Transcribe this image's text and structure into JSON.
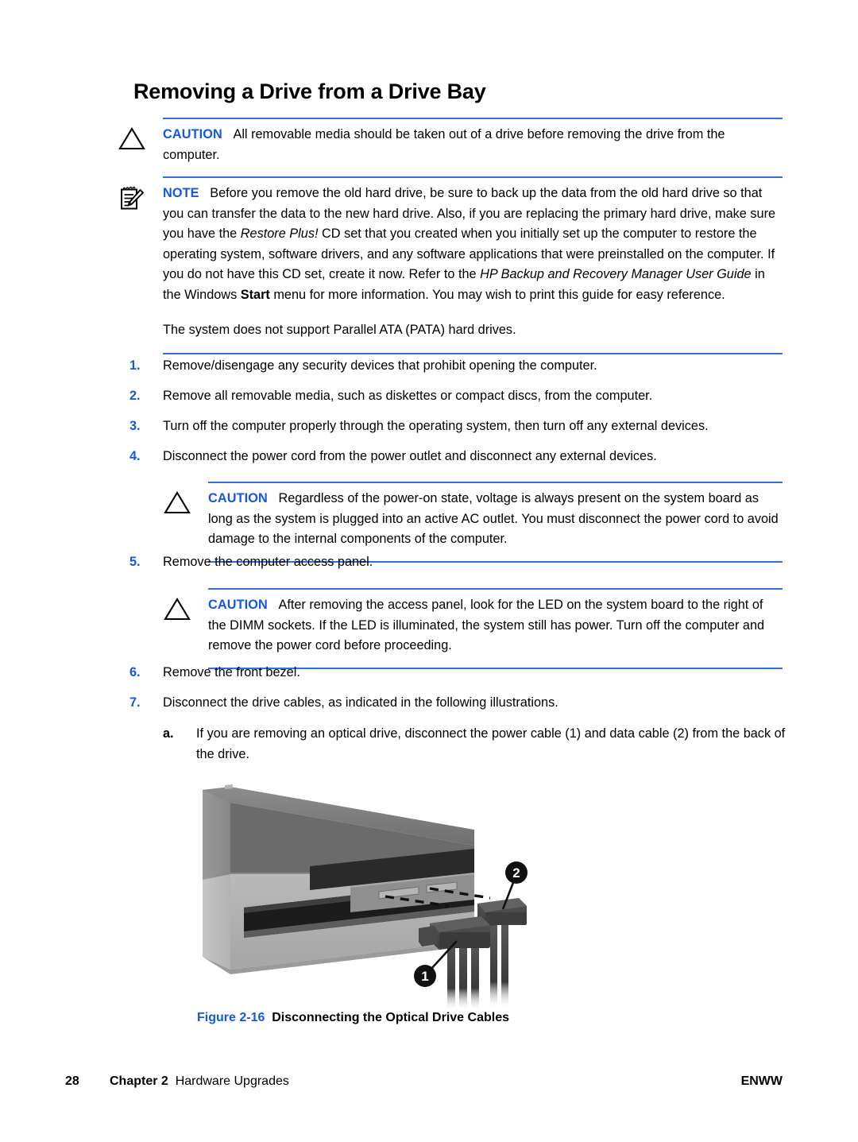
{
  "document": {
    "title": "Removing a Drive from a Drive Bay"
  },
  "colors": {
    "accent_blue": "#1557e0",
    "rule_blue": "#2f6fe0",
    "text_black": "#000000",
    "page_background": "#ffffff"
  },
  "admonitions": [
    {
      "id": "caution-removable-media",
      "icon": "caution-triangle-icon",
      "label": "CAUTION",
      "paragraphs": [
        "All removable media should be taken out of a drive before removing the drive from the computer."
      ]
    },
    {
      "id": "note-backup-data",
      "icon": "note-pad-icon",
      "label": "NOTE",
      "paragraphs": [
        "Before you remove the old hard drive, be sure to back up the data from the old hard drive so that you can transfer the data to the new hard drive. Also, if you are replacing the primary hard drive, make sure you have the Restore Plus! CD set that you created when you initially set up the computer to restore the operating system, software drivers, and any software applications that were preinstalled on the computer. If you do not have this CD set, create it now. Refer to the HP Backup and Recovery Manager User Guide in the Windows Start menu for more information. You may wish to print this guide for easy reference.",
        "The system does not support Parallel ATA (PATA) hard drives."
      ],
      "emphasis": {
        "italic_1": "Restore Plus!",
        "italic_2": "HP Backup and Recovery Manager User Guide",
        "bold_1": "Start"
      }
    },
    {
      "id": "caution-voltage-present",
      "icon": "caution-triangle-icon",
      "label": "CAUTION",
      "paragraphs": [
        "Regardless of the power-on state, voltage is always present on the system board as long as the system is plugged into an active AC outlet. You must disconnect the power cord to avoid damage to the internal components of the computer."
      ]
    },
    {
      "id": "caution-led-check",
      "icon": "caution-triangle-icon",
      "label": "CAUTION",
      "paragraphs": [
        "After removing the access panel, look for the LED on the system board to the right of the DIMM sockets. If the LED is illuminated, the system still has power. Turn off the computer and remove the power cord before proceeding."
      ]
    }
  ],
  "steps": [
    {
      "num": "1.",
      "text": "Remove/disengage any security devices that prohibit opening the computer."
    },
    {
      "num": "2.",
      "text": "Remove all removable media, such as diskettes or compact discs, from the computer."
    },
    {
      "num": "3.",
      "text": "Turn off the computer properly through the operating system, then turn off any external devices."
    },
    {
      "num": "4.",
      "text": "Disconnect the power cord from the power outlet and disconnect any external devices."
    },
    {
      "num": "5.",
      "text": "Remove the computer access panel."
    },
    {
      "num": "6.",
      "text": "Remove the front bezel."
    },
    {
      "num": "7.",
      "text": "Disconnect the drive cables, as indicated in the following illustrations."
    }
  ],
  "substeps": [
    {
      "num": "a.",
      "text": "If you are removing an optical drive, disconnect the power cable (1) and data cable (2) from the back of the drive."
    }
  ],
  "figure": {
    "number": "Figure 2-16",
    "title": "Disconnecting the Optical Drive Cables",
    "callouts": [
      {
        "id": "1",
        "label": "1",
        "meaning": "power cable connector"
      },
      {
        "id": "2",
        "label": "2",
        "meaning": "data cable connector"
      }
    ],
    "alt": "Line drawing of an optical drive viewed from the rear with power and data cable connectors being pulled away"
  },
  "footer": {
    "page_number": "28",
    "chapter_label": "Chapter 2",
    "chapter_title": "Hardware Upgrades",
    "right_label": "ENWW"
  }
}
